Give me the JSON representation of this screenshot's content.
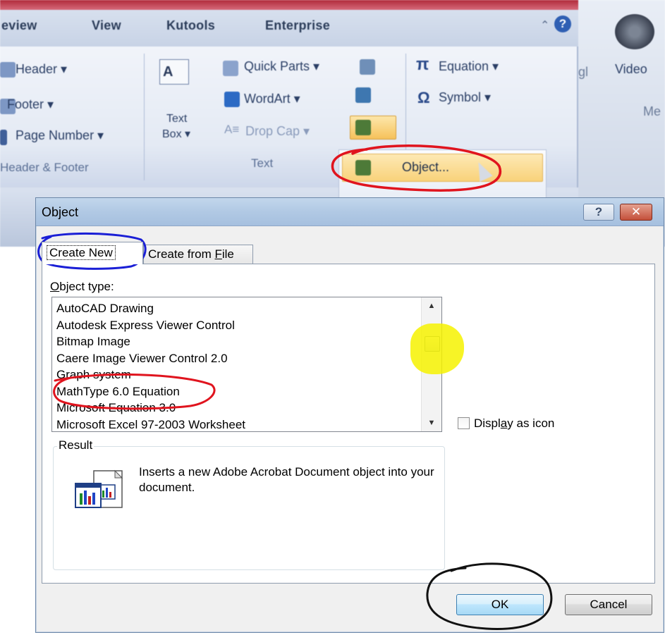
{
  "ribbon": {
    "tabs": [
      "eview",
      "View",
      "Kutools",
      "Enterprise"
    ],
    "header_footer": {
      "header": "Header ▾",
      "footer": "Footer ▾",
      "page_number": "Page Number ▾",
      "group_label": "Header & Footer"
    },
    "text_group": {
      "text_box_line1": "Text",
      "text_box_line2": "Box ▾",
      "quick_parts": "Quick Parts ▾",
      "wordart": "WordArt ▾",
      "drop_cap": "Drop Cap ▾",
      "group_label": "Text"
    },
    "symbols": {
      "equation": "Equation ▾",
      "symbol": "Symbol ▾",
      "pi_glyph": "π",
      "omega_glyph": "Ω"
    },
    "media": {
      "video": "Video",
      "partial_label": "Me",
      "partial_left": "gl"
    },
    "dropdown": {
      "object_item": "Object..."
    }
  },
  "dialog": {
    "title": "Object",
    "help_glyph": "?",
    "close_glyph": "✕",
    "tabs": {
      "create_new": "Create New",
      "create_from_file_prefix": "Create from ",
      "create_from_file_underline": "F",
      "create_from_file_suffix": "ile"
    },
    "object_type_label_underline": "O",
    "object_type_label_rest": "bject type:",
    "object_types": [
      "AutoCAD Drawing",
      "Autodesk Express Viewer Control",
      "Bitmap Image",
      "Caere Image Viewer Control 2.0",
      "Graph system",
      "MathType 6.0 Equation",
      "Microsoft Equation 3.0",
      "Microsoft Excel 97-2003 Worksheet"
    ],
    "display_as_icon_prefix": "Displ",
    "display_as_icon_underline": "a",
    "display_as_icon_suffix": "y as icon",
    "result_label": "Result",
    "result_description": "Inserts a new Adobe Acrobat Document object into your document.",
    "ok_label": "OK",
    "cancel_label": "Cancel"
  },
  "colors": {
    "annotation_red": "#e0141e",
    "annotation_blue": "#1a1fd6",
    "annotation_black": "#111111",
    "annotation_yellow": "#f6f200",
    "dropdown_highlight": "#f9d27a"
  }
}
